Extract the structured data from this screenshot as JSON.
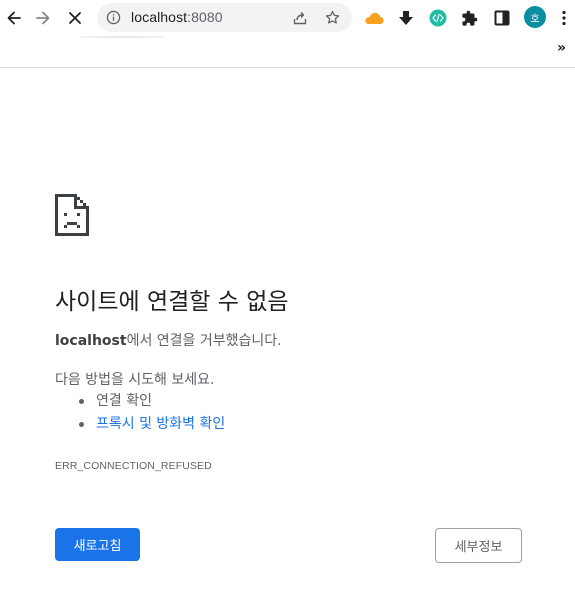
{
  "browser": {
    "address": "localhost",
    "port": ":8080",
    "avatar_initial": "호",
    "overflow_chevron": "»",
    "icons": {
      "back": "arrow-left-icon",
      "forward": "arrow-right-icon",
      "stop": "close-icon",
      "site_info": "info-icon",
      "share": "share-icon",
      "bookmark": "star-icon",
      "ext_cloud": "cloud-icon",
      "ext_download": "download-icon",
      "ext_code": "code-icon",
      "extensions": "puzzle-icon",
      "side_panel": "side-panel-icon",
      "menu": "kebab-menu-icon"
    },
    "colors": {
      "cloud": "#f6a21e",
      "code_ext": "#1ebea5",
      "avatar_bg": "#0b8ea3"
    }
  },
  "error": {
    "heading": "사이트에 연결할 수 없음",
    "summary_host": "localhost",
    "summary_rest": "에서 연결을 거부했습니다.",
    "suggest_title": "다음 방법을 시도해 보세요.",
    "suggestions": [
      {
        "label": "연결 확인",
        "link": false
      },
      {
        "label": "프록시 및 방화벽 확인",
        "link": true
      }
    ],
    "code": "ERR_CONNECTION_REFUSED",
    "reload_label": "새로고침",
    "details_label": "세부정보",
    "icon": "sad-page-icon",
    "colors": {
      "primary": "#1a73e8",
      "text": "#202124",
      "secondary_text": "#5f6368"
    }
  }
}
